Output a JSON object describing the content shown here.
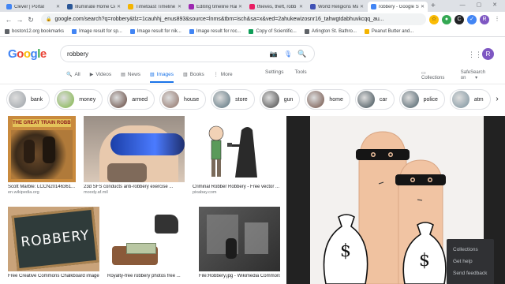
{
  "browser": {
    "tabs": [
      {
        "title": "Clever | Portal",
        "color": "#4285f4",
        "active": false
      },
      {
        "title": "Illuminate Home Ce",
        "color": "#2b5797",
        "active": false
      },
      {
        "title": "Timetoast Timeline",
        "color": "#f4b400",
        "active": false
      },
      {
        "title": "Editing timeline Rai",
        "color": "#9c27b0",
        "active": false
      },
      {
        "title": "thieves, theft, robb",
        "color": "#e91e63",
        "active": false
      },
      {
        "title": "World Religions Ma",
        "color": "#3f51b5",
        "active": false
      },
      {
        "title": "robbery - Google S",
        "color": "#4285f4",
        "active": true
      }
    ],
    "url": "google.com/search?q=robbery&tlz=1cauhhj_enus893&source=lnms&tbm=isch&sa=x&ved=2ahukewizosnr16_tahwgtdabhuvkcqq_au...",
    "bookmarks": [
      {
        "label": "boston12.org bookmarks",
        "color": "#5f6368"
      },
      {
        "label": "Image result for sp...",
        "color": "#4285f4"
      },
      {
        "label": "Image result for nik...",
        "color": "#4285f4"
      },
      {
        "label": "Image result for roc...",
        "color": "#4285f4"
      },
      {
        "label": "Copy of Scientific...",
        "color": "#0f9d58"
      },
      {
        "label": "Arlington St. Bathro...",
        "color": "#5f6368"
      },
      {
        "label": "Peanut Butter and...",
        "color": "#f4b400"
      }
    ]
  },
  "google": {
    "logo": "Google",
    "query": "robbery",
    "avatar_letter": "R",
    "tabs": [
      {
        "label": "All",
        "icon": "search-icon",
        "glyph": "🔍",
        "active": false
      },
      {
        "label": "Videos",
        "icon": "video-icon",
        "glyph": "▶",
        "active": false
      },
      {
        "label": "News",
        "icon": "news-icon",
        "glyph": "▤",
        "active": false
      },
      {
        "label": "Images",
        "icon": "image-icon",
        "glyph": "▧",
        "active": true
      },
      {
        "label": "Books",
        "icon": "book-icon",
        "glyph": "▥",
        "active": false
      },
      {
        "label": "More",
        "icon": "more-icon",
        "glyph": "⋮",
        "active": false
      }
    ],
    "settings_label": "Settings",
    "tools_label": "Tools",
    "collections_label": "Collections",
    "safesearch_label": "SafeSearch on",
    "chips": [
      "bank",
      "money",
      "armed",
      "house",
      "store",
      "gun",
      "home",
      "car",
      "police",
      "atm"
    ],
    "results": [
      {
        "caption": "Scott Marble: LCCN2014636​1...",
        "source": "en.wikipedia.org"
      },
      {
        "caption": "23d SFS conducts anti-robbery exercise ...",
        "source": "moody.af.mil"
      },
      {
        "caption": "Criminal Robber Robbery - Free vector ...",
        "source": "pixabay.com"
      },
      {
        "caption": "Free Creative Commons Chalkboard image ...",
        "source": "",
        "board_text": "ROBBERY"
      },
      {
        "caption": "Royalty-free robbery photos free ...",
        "source": ""
      },
      {
        "caption": "File:Robbery.jpg - Wikimedia Commons",
        "source": ""
      }
    ],
    "poster_text": "THE GREAT TRAIN ROBBERY",
    "menu": [
      "Collections",
      "Get help",
      "Send feedback"
    ]
  },
  "colors": {
    "accent": "#1a73e8",
    "g_blue": "#4285f4",
    "g_red": "#ea4335",
    "g_yellow": "#fbbc05",
    "g_green": "#34a853"
  }
}
